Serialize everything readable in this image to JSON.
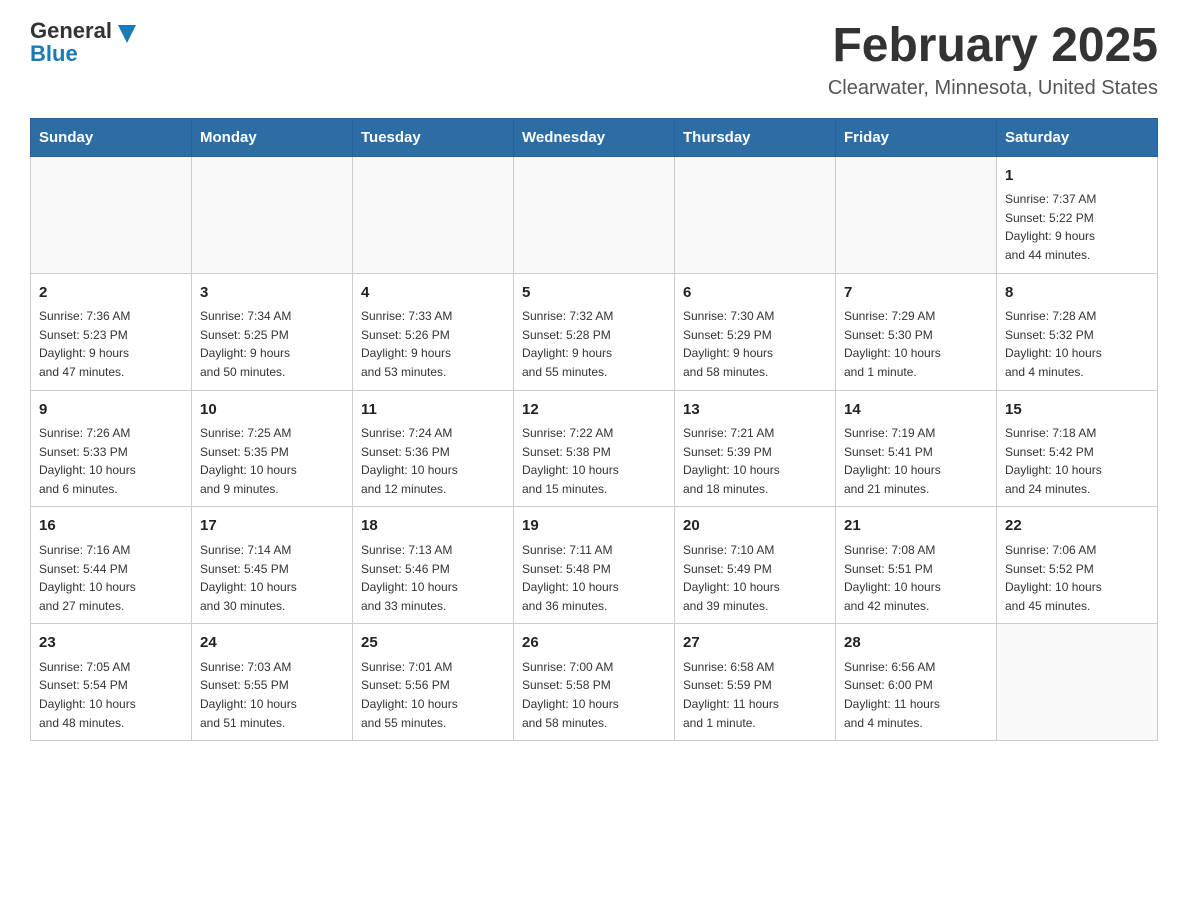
{
  "header": {
    "logo": {
      "general": "General",
      "blue": "Blue"
    },
    "title": "February 2025",
    "subtitle": "Clearwater, Minnesota, United States"
  },
  "weekdays": [
    "Sunday",
    "Monday",
    "Tuesday",
    "Wednesday",
    "Thursday",
    "Friday",
    "Saturday"
  ],
  "weeks": [
    [
      {
        "day": "",
        "info": ""
      },
      {
        "day": "",
        "info": ""
      },
      {
        "day": "",
        "info": ""
      },
      {
        "day": "",
        "info": ""
      },
      {
        "day": "",
        "info": ""
      },
      {
        "day": "",
        "info": ""
      },
      {
        "day": "1",
        "info": "Sunrise: 7:37 AM\nSunset: 5:22 PM\nDaylight: 9 hours\nand 44 minutes."
      }
    ],
    [
      {
        "day": "2",
        "info": "Sunrise: 7:36 AM\nSunset: 5:23 PM\nDaylight: 9 hours\nand 47 minutes."
      },
      {
        "day": "3",
        "info": "Sunrise: 7:34 AM\nSunset: 5:25 PM\nDaylight: 9 hours\nand 50 minutes."
      },
      {
        "day": "4",
        "info": "Sunrise: 7:33 AM\nSunset: 5:26 PM\nDaylight: 9 hours\nand 53 minutes."
      },
      {
        "day": "5",
        "info": "Sunrise: 7:32 AM\nSunset: 5:28 PM\nDaylight: 9 hours\nand 55 minutes."
      },
      {
        "day": "6",
        "info": "Sunrise: 7:30 AM\nSunset: 5:29 PM\nDaylight: 9 hours\nand 58 minutes."
      },
      {
        "day": "7",
        "info": "Sunrise: 7:29 AM\nSunset: 5:30 PM\nDaylight: 10 hours\nand 1 minute."
      },
      {
        "day": "8",
        "info": "Sunrise: 7:28 AM\nSunset: 5:32 PM\nDaylight: 10 hours\nand 4 minutes."
      }
    ],
    [
      {
        "day": "9",
        "info": "Sunrise: 7:26 AM\nSunset: 5:33 PM\nDaylight: 10 hours\nand 6 minutes."
      },
      {
        "day": "10",
        "info": "Sunrise: 7:25 AM\nSunset: 5:35 PM\nDaylight: 10 hours\nand 9 minutes."
      },
      {
        "day": "11",
        "info": "Sunrise: 7:24 AM\nSunset: 5:36 PM\nDaylight: 10 hours\nand 12 minutes."
      },
      {
        "day": "12",
        "info": "Sunrise: 7:22 AM\nSunset: 5:38 PM\nDaylight: 10 hours\nand 15 minutes."
      },
      {
        "day": "13",
        "info": "Sunrise: 7:21 AM\nSunset: 5:39 PM\nDaylight: 10 hours\nand 18 minutes."
      },
      {
        "day": "14",
        "info": "Sunrise: 7:19 AM\nSunset: 5:41 PM\nDaylight: 10 hours\nand 21 minutes."
      },
      {
        "day": "15",
        "info": "Sunrise: 7:18 AM\nSunset: 5:42 PM\nDaylight: 10 hours\nand 24 minutes."
      }
    ],
    [
      {
        "day": "16",
        "info": "Sunrise: 7:16 AM\nSunset: 5:44 PM\nDaylight: 10 hours\nand 27 minutes."
      },
      {
        "day": "17",
        "info": "Sunrise: 7:14 AM\nSunset: 5:45 PM\nDaylight: 10 hours\nand 30 minutes."
      },
      {
        "day": "18",
        "info": "Sunrise: 7:13 AM\nSunset: 5:46 PM\nDaylight: 10 hours\nand 33 minutes."
      },
      {
        "day": "19",
        "info": "Sunrise: 7:11 AM\nSunset: 5:48 PM\nDaylight: 10 hours\nand 36 minutes."
      },
      {
        "day": "20",
        "info": "Sunrise: 7:10 AM\nSunset: 5:49 PM\nDaylight: 10 hours\nand 39 minutes."
      },
      {
        "day": "21",
        "info": "Sunrise: 7:08 AM\nSunset: 5:51 PM\nDaylight: 10 hours\nand 42 minutes."
      },
      {
        "day": "22",
        "info": "Sunrise: 7:06 AM\nSunset: 5:52 PM\nDaylight: 10 hours\nand 45 minutes."
      }
    ],
    [
      {
        "day": "23",
        "info": "Sunrise: 7:05 AM\nSunset: 5:54 PM\nDaylight: 10 hours\nand 48 minutes."
      },
      {
        "day": "24",
        "info": "Sunrise: 7:03 AM\nSunset: 5:55 PM\nDaylight: 10 hours\nand 51 minutes."
      },
      {
        "day": "25",
        "info": "Sunrise: 7:01 AM\nSunset: 5:56 PM\nDaylight: 10 hours\nand 55 minutes."
      },
      {
        "day": "26",
        "info": "Sunrise: 7:00 AM\nSunset: 5:58 PM\nDaylight: 10 hours\nand 58 minutes."
      },
      {
        "day": "27",
        "info": "Sunrise: 6:58 AM\nSunset: 5:59 PM\nDaylight: 11 hours\nand 1 minute."
      },
      {
        "day": "28",
        "info": "Sunrise: 6:56 AM\nSunset: 6:00 PM\nDaylight: 11 hours\nand 4 minutes."
      },
      {
        "day": "",
        "info": ""
      }
    ]
  ]
}
